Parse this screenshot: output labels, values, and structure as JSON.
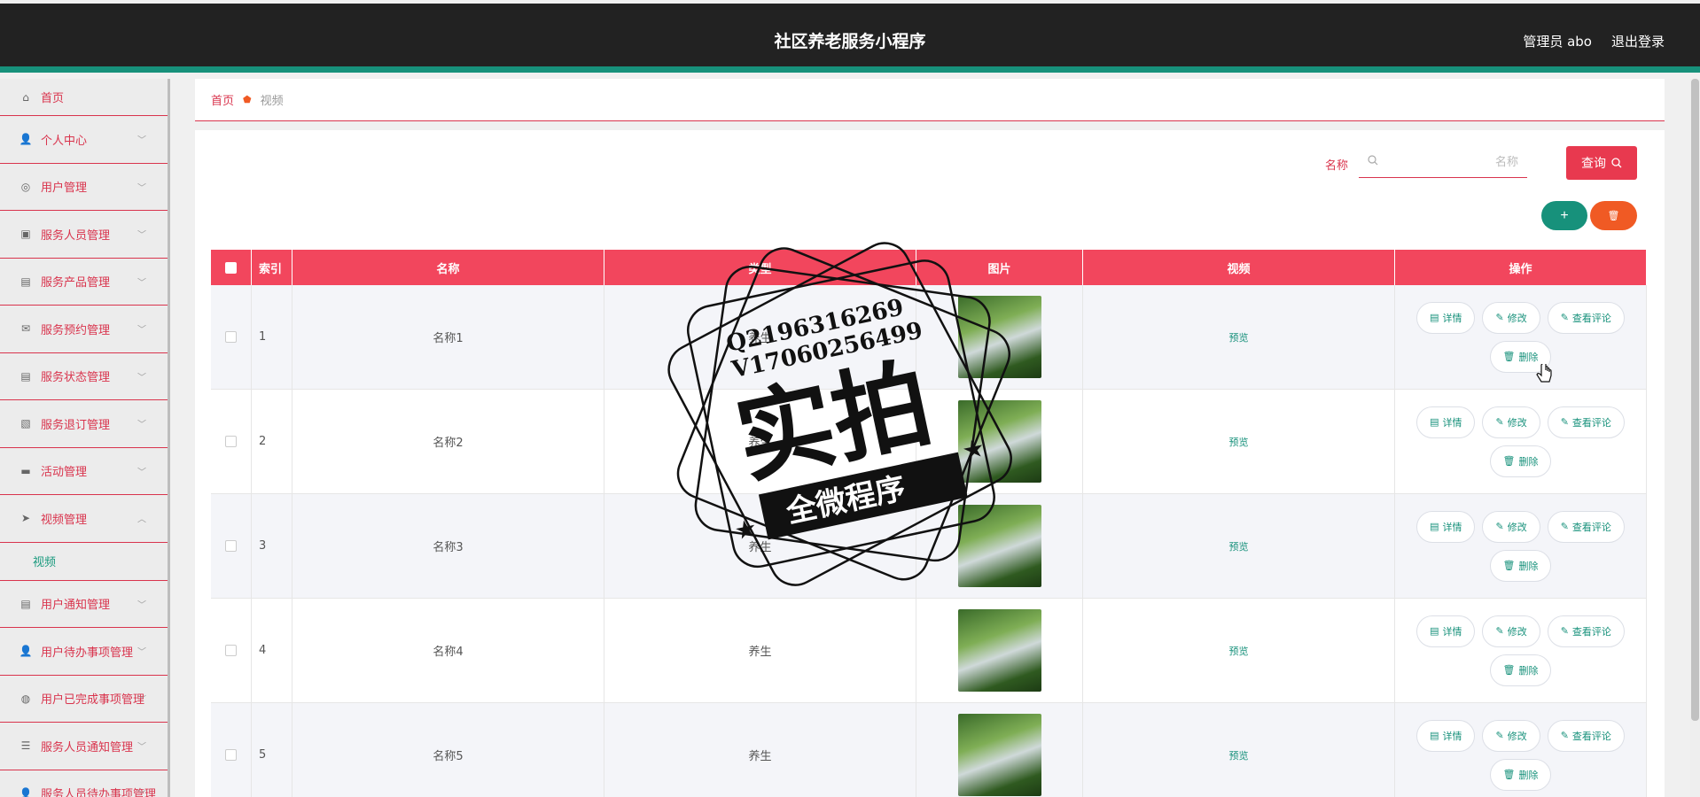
{
  "header": {
    "title": "社区养老服务小程序",
    "admin": "管理员 abo",
    "logout": "退出登录"
  },
  "sidebar": {
    "items": [
      {
        "label": "首页",
        "icon": "home-icon",
        "glyph": "⌂"
      },
      {
        "label": "个人中心",
        "icon": "user-icon",
        "glyph": "👤"
      },
      {
        "label": "用户管理",
        "icon": "support-icon",
        "glyph": "◎"
      },
      {
        "label": "服务人员管理",
        "icon": "briefcase-icon",
        "glyph": "▣"
      },
      {
        "label": "服务产品管理",
        "icon": "clipboard-check-icon",
        "glyph": "▤"
      },
      {
        "label": "服务预约管理",
        "icon": "mail-icon",
        "glyph": "✉"
      },
      {
        "label": "服务状态管理",
        "icon": "clipboard-icon",
        "glyph": "▤"
      },
      {
        "label": "服务退订管理",
        "icon": "chart-icon",
        "glyph": "▧"
      },
      {
        "label": "活动管理",
        "icon": "monitor-icon",
        "glyph": "▬"
      },
      {
        "label": "视频管理",
        "icon": "send-icon",
        "glyph": "➤"
      },
      {
        "label": "用户通知管理",
        "icon": "clipboard-x-icon",
        "glyph": "▤"
      },
      {
        "label": "用户待办事项管理",
        "icon": "user-icon",
        "glyph": "👤"
      },
      {
        "label": "用户已完成事项管理",
        "icon": "compass-icon",
        "glyph": "◍"
      },
      {
        "label": "服务人员通知管理",
        "icon": "list-icon",
        "glyph": "☰"
      },
      {
        "label": "服务人员待办事项管理",
        "icon": "user-icon",
        "glyph": "👤"
      }
    ],
    "sub_video": "视频"
  },
  "breadcrumb": {
    "home": "首页",
    "current": "视频"
  },
  "search": {
    "label": "名称",
    "placeholder": "名称",
    "button": "查询"
  },
  "toolbar": {
    "add": "+",
    "delete": "🗑"
  },
  "table": {
    "headers": {
      "index": "索引",
      "name": "名称",
      "type": "类型",
      "image": "图片",
      "video": "视频",
      "ops": "操作"
    },
    "rows": [
      {
        "index": "1",
        "name": "名称1",
        "type": "养生",
        "video": "预览"
      },
      {
        "index": "2",
        "name": "名称2",
        "type": "养生",
        "video": "预览"
      },
      {
        "index": "3",
        "name": "名称3",
        "type": "养生",
        "video": "预览"
      },
      {
        "index": "4",
        "name": "名称4",
        "type": "养生",
        "video": "预览"
      },
      {
        "index": "5",
        "name": "名称5",
        "type": "养生",
        "video": "预览"
      }
    ],
    "ops": {
      "detail": "详情",
      "edit": "修改",
      "comments": "查看评论",
      "delete": "删除"
    }
  },
  "watermark": {
    "line1": "Q2196316269",
    "line2": "V17060256499",
    "big": "实拍",
    "ribbon": "全微程序"
  },
  "colors": {
    "accent": "#e8394f",
    "teal": "#17917b",
    "orange": "#f05a24",
    "header_bg": "#222222"
  }
}
